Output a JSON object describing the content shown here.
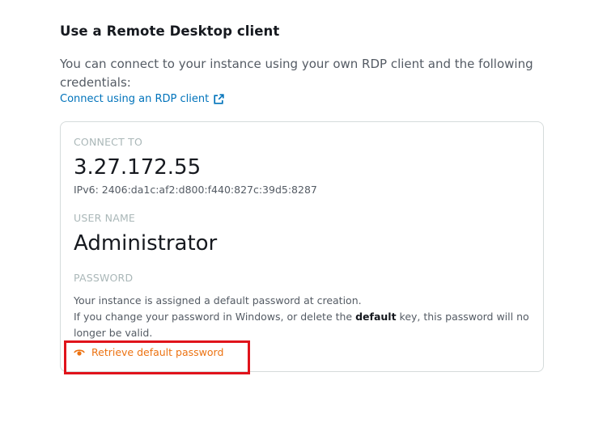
{
  "section": {
    "title": "Use a Remote Desktop client",
    "description": "You can connect to your instance using your own RDP client and the following credentials:",
    "rdp_link": "Connect using an RDP client"
  },
  "connect_to": {
    "label": "CONNECT TO",
    "ip": "3.27.172.55",
    "ipv6": "IPv6: 2406:da1c:af2:d800:f440:827c:39d5:8287"
  },
  "user_name": {
    "label": "USER NAME",
    "value": "Administrator"
  },
  "password": {
    "label": "PASSWORD",
    "line1": "Your instance is assigned a default password at creation.",
    "line2_before": "If you change your password in Windows, or delete the ",
    "line2_bold": "default",
    "line2_after": " key, this password will no longer be valid.",
    "retrieve_link": "Retrieve default password"
  },
  "colors": {
    "link_blue": "#0073bb",
    "action_orange": "#ec7211",
    "highlight_red": "#e0131b"
  },
  "icons": {
    "external": "external-link-icon",
    "eye": "eye-icon"
  }
}
